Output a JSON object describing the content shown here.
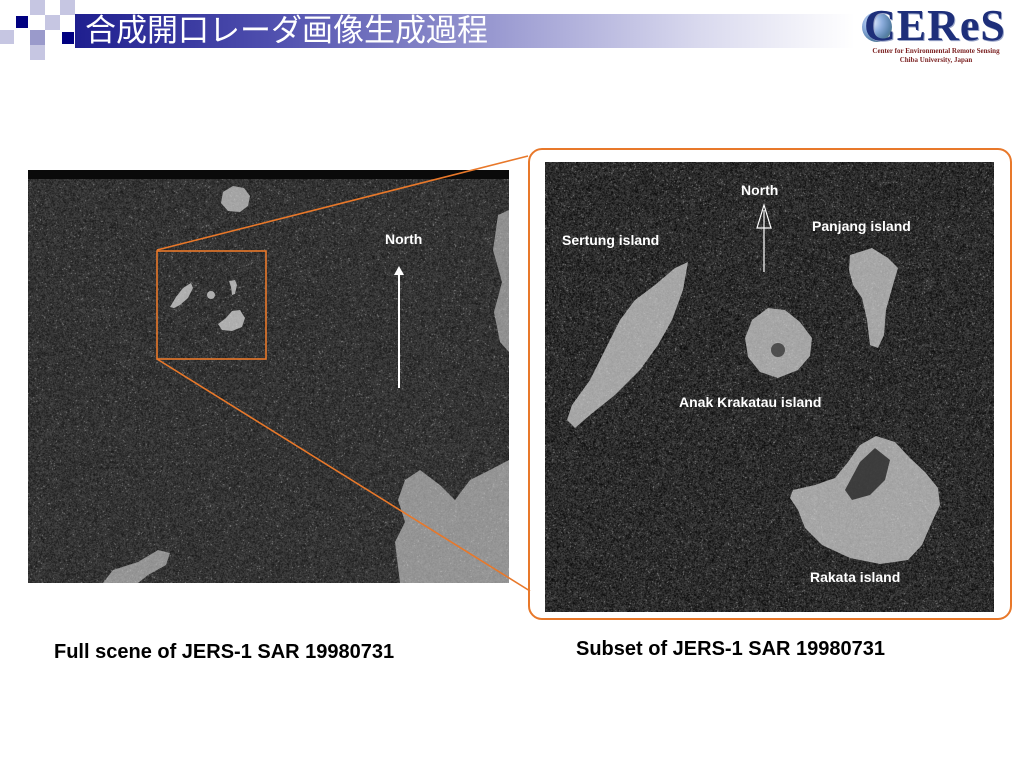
{
  "slide": {
    "title": "合成開口レーダ画像生成過程",
    "logo": {
      "name": "CEReS",
      "line1": "Center for Environmental Remote Sensing",
      "line2": "Chiba University, Japan"
    }
  },
  "full_scene": {
    "north_label": "North",
    "caption": "Full scene of JERS-1 SAR 19980731"
  },
  "subset": {
    "north_label": "North",
    "caption": "Subset of JERS-1 SAR 19980731",
    "islands": {
      "sertung": "Sertung island",
      "panjang": "Panjang island",
      "anak_krakatau": "Anak Krakatau island",
      "rakata": "Rakata island"
    }
  },
  "colors": {
    "title_bar": "#1f1f8f",
    "accent_orange": "#e8782a",
    "logo_blue": "#1e2f7a",
    "logo_red": "#7a1f1f",
    "decor_navy": "#000080",
    "decor_lavender": "#c6c6e2"
  }
}
